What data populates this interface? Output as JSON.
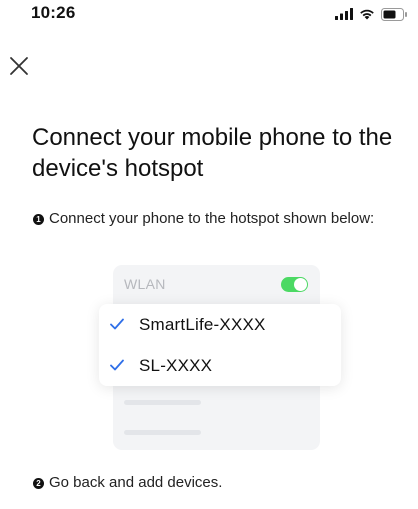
{
  "status_bar": {
    "time": "10:26"
  },
  "header": {
    "close_icon": "close-icon"
  },
  "page": {
    "title": "Connect your mobile phone to the device's hotspot"
  },
  "steps": [
    {
      "number": "1",
      "text": "Connect your phone to the hotspot shown below:"
    },
    {
      "number": "2",
      "text": "Go back and add devices."
    }
  ],
  "illustration": {
    "wlan_label": "WLAN",
    "wlan_toggle_on": true,
    "networks": [
      {
        "name": "SmartLife-XXXX",
        "checked": true
      },
      {
        "name": "SL-XXXX",
        "checked": true
      }
    ]
  },
  "colors": {
    "toggle_on": "#4cd964",
    "check": "#2f6fe8",
    "panel_bg": "#f3f4f6"
  }
}
